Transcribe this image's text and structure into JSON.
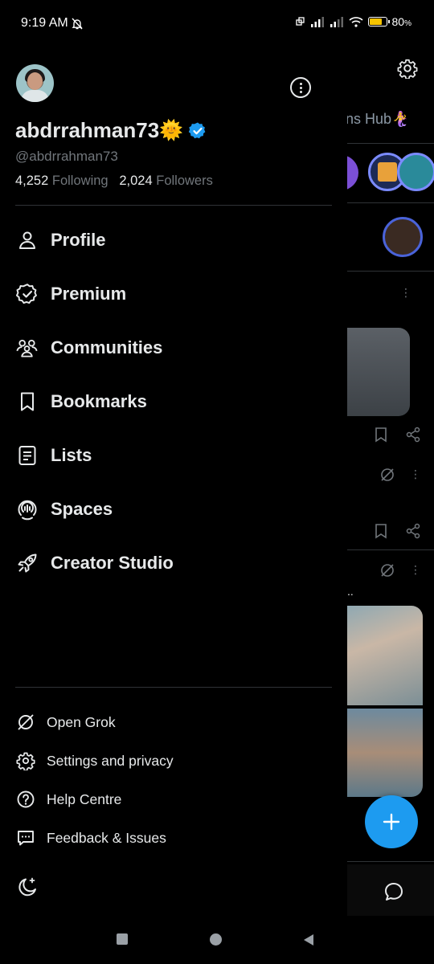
{
  "status_bar": {
    "time": "9:19 AM",
    "battery": "80",
    "battery_level": 0.8
  },
  "profile": {
    "display_name": "abdrrahman73",
    "emoji": "🌞",
    "handle": "@abdrrahman73",
    "following_count": "4,252",
    "following_label": "Following",
    "followers_count": "2,024",
    "followers_label": "Followers"
  },
  "menu": [
    {
      "label": "Profile",
      "icon": "person-icon"
    },
    {
      "label": "Premium",
      "icon": "verified-badge-icon"
    },
    {
      "label": "Communities",
      "icon": "communities-icon"
    },
    {
      "label": "Bookmarks",
      "icon": "bookmark-icon"
    },
    {
      "label": "Lists",
      "icon": "list-icon"
    },
    {
      "label": "Spaces",
      "icon": "spaces-icon"
    },
    {
      "label": "Creator Studio",
      "icon": "rocket-icon"
    }
  ],
  "secondary_menu": [
    {
      "label": "Open Grok",
      "icon": "grok-icon"
    },
    {
      "label": "Settings and privacy",
      "icon": "gear-icon"
    },
    {
      "label": "Help Centre",
      "icon": "help-icon"
    },
    {
      "label": "Feedback & Issues",
      "icon": "feedback-icon"
    }
  ],
  "background_feed": {
    "tab_fragment": "ns Hub",
    "tab_emoji": "🧜‍♀️",
    "ellipsis": ".."
  },
  "colors": {
    "accent": "#1d9bf0",
    "background": "#000000",
    "text": "#e7e9ea",
    "secondary_text": "#71767b",
    "divider": "#2f3336"
  }
}
